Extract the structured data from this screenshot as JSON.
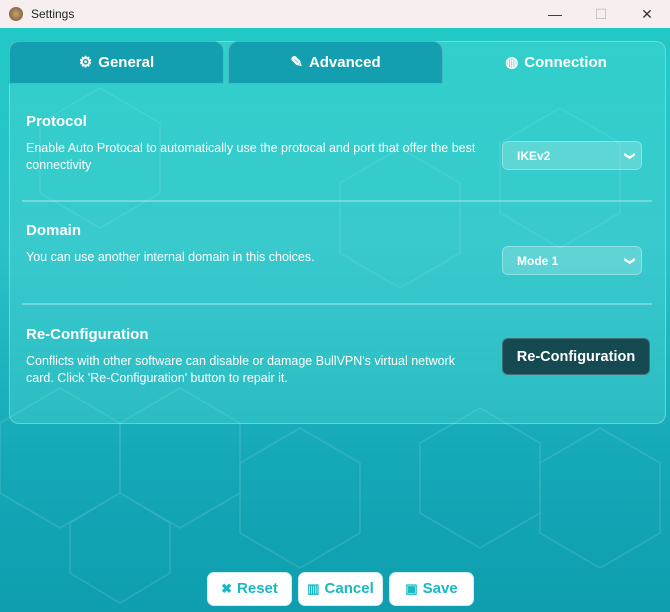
{
  "window": {
    "title": "Settings"
  },
  "tabs": [
    {
      "label": "General",
      "icon": "gear-icon"
    },
    {
      "label": "Advanced",
      "icon": "wrench-icon"
    },
    {
      "label": "Connection",
      "icon": "globe-icon"
    }
  ],
  "protocol": {
    "title": "Protocol",
    "description": "Enable Auto Protocal to automatically use the protocal and port that offer the best connectivity",
    "value": "IKEv2"
  },
  "domain": {
    "title": "Domain",
    "description": "You can use another internal domain in this choices.",
    "value": "Mode 1"
  },
  "reconfiguration": {
    "title": "Re-Configuration",
    "description": "Conflicts with other software can disable or damage BullVPN's virtual network card. Click 'Re-Configuration' button to repair it.",
    "button": "Re-Configuration"
  },
  "footer": {
    "reset": "Reset",
    "cancel": "Cancel",
    "save": "Save"
  }
}
